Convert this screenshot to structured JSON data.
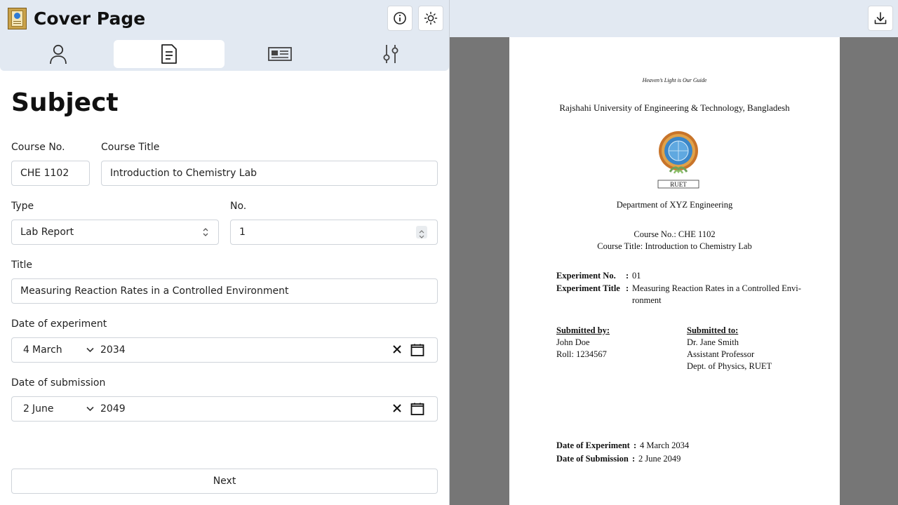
{
  "app": {
    "title": "Cover Page"
  },
  "tabs": [
    {
      "name": "person",
      "active": false
    },
    {
      "name": "subject",
      "active": true
    },
    {
      "name": "card",
      "active": false
    },
    {
      "name": "settings",
      "active": false
    }
  ],
  "form": {
    "section_title": "Subject",
    "course_no": {
      "label": "Course No.",
      "value": "CHE 1102"
    },
    "course_title": {
      "label": "Course Title",
      "value": "Introduction to Chemistry Lab"
    },
    "type": {
      "label": "Type",
      "value": "Lab Report"
    },
    "no": {
      "label": "No.",
      "value": "1"
    },
    "title": {
      "label": "Title",
      "value": "Measuring Reaction Rates in a Controlled Environment"
    },
    "date_experiment": {
      "label": "Date of experiment",
      "day": "4",
      "month": "March",
      "year": "2034"
    },
    "date_submission": {
      "label": "Date of submission",
      "day": "2",
      "month": "June",
      "year": "2049"
    },
    "next_label": "Next"
  },
  "preview": {
    "motto": "Heaven’s Light is Our Guide",
    "university": "Rajshahi University of Engineering & Technology, Bangladesh",
    "seal_text": "RUET",
    "department": "Department of XYZ Engineering",
    "course_no_line": "Course No.: CHE 1102",
    "course_title_line": "Course Title: Introduction to Chemistry Lab",
    "experiment_no_label": "Experiment No.",
    "experiment_no_value": "01",
    "experiment_title_label": "Experiment Title",
    "experiment_title_value_1": "Measuring Reaction Rates in a Controlled Envi-",
    "experiment_title_value_2": "ronment",
    "colon": ":",
    "submitted_by_label": "Submitted by:",
    "submitted_by_name": "John Doe",
    "submitted_by_roll": "Roll: 1234567",
    "submitted_to_label": "Submitted to:",
    "submitted_to_name": "Dr. Jane Smith",
    "submitted_to_title": "Assistant Professor",
    "submitted_to_dept": "Dept. of Physics, RUET",
    "date_experiment_label": "Date of Experiment",
    "date_experiment_value": "4 March 2034",
    "date_submission_label": "Date of Submission",
    "date_submission_value": "2 June 2049"
  },
  "colors": {
    "header_bg": "#e2e9f2",
    "preview_bg": "#767676",
    "paper_bg": "#ffffff"
  }
}
